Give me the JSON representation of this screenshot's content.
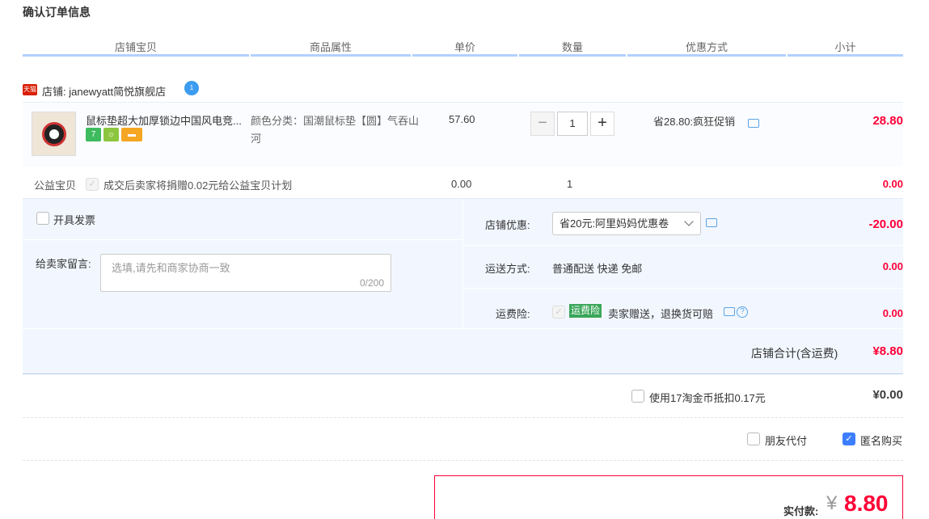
{
  "page_title": "确认订单信息",
  "columns": [
    "店铺宝贝",
    "商品属性",
    "单价",
    "数量",
    "优惠方式",
    "小计"
  ],
  "shop": {
    "badge": "天猫",
    "label": "店铺: janewyatt简悦旗舰店",
    "wangwang_badge": "1"
  },
  "item": {
    "name": "鼠标垫超大加厚锁边中国风电竞...",
    "badges": [
      {
        "text": "7",
        "color": "#3dbb5e"
      },
      {
        "text": "☼",
        "color": "#8cc63f"
      },
      {
        "text": "▬",
        "color": "#f5a623"
      }
    ],
    "attr": "颜色分类：国潮鼠标垫【圆】气吞山河",
    "price": "57.60",
    "qty_minus": "−",
    "qty": "1",
    "qty_plus": "+",
    "promo": "省28.80:疯狂促销",
    "subtotal": "28.80"
  },
  "charity": {
    "label": "公益宝贝",
    "text": "成交后卖家将捐赠0.02元给公益宝贝计划",
    "price": "0.00",
    "qty": "1",
    "subtotal": "0.00"
  },
  "invoice": {
    "label": "开具发票"
  },
  "message": {
    "label": "给卖家留言:",
    "placeholder": "选填,请先和商家协商一致",
    "counter": "0/200"
  },
  "shop_coupon": {
    "label": "店铺优惠:",
    "selected": "省20元:阿里妈妈优惠卷",
    "amount": "-20.00"
  },
  "shipping": {
    "label": "运送方式:",
    "value": "普通配送 快递 免邮",
    "amount": "0.00"
  },
  "insurance": {
    "label": "运费险:",
    "tag": "运费险",
    "text": "卖家赠送，退换货可赔",
    "amount": "0.00"
  },
  "shop_total": {
    "label": "店铺合计(含运费)",
    "amount": "¥8.80"
  },
  "coins": {
    "text": "使用17淘金币抵扣0.17元",
    "amount": "¥0.00"
  },
  "friend_pay": {
    "label": "朋友代付"
  },
  "anonymous": {
    "label": "匿名购买",
    "checked": true
  },
  "final": {
    "label": "实付款:",
    "currency": "¥",
    "amount": "8.80"
  },
  "colors": {
    "price_red": "#ff0036",
    "header_line": "#b2d1ff",
    "options_bg": "#f2f7ff"
  }
}
